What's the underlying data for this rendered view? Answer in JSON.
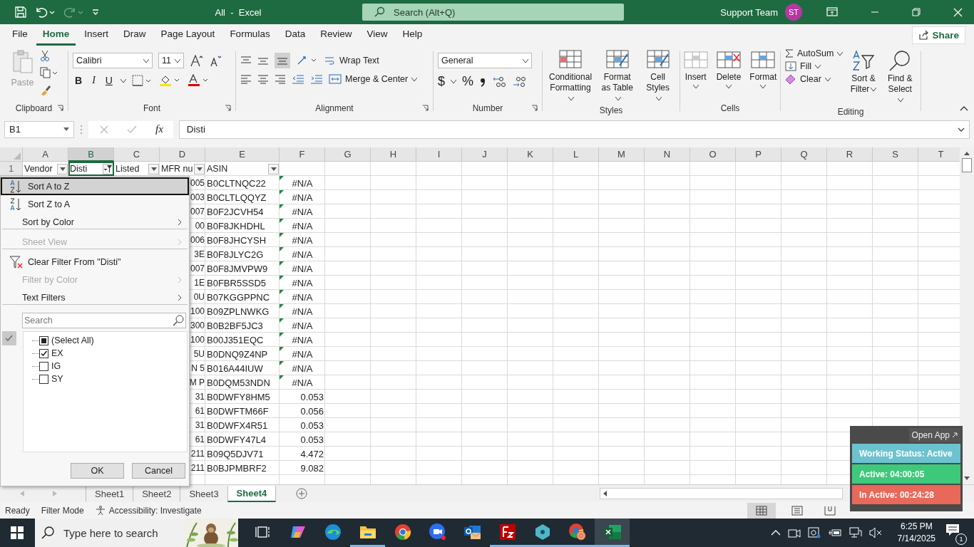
{
  "title_bar": {
    "document": "All  -  Excel",
    "search_placeholder": "Search (Alt+Q)",
    "user": "Support Team",
    "avatar_initials": "ST"
  },
  "menu_tabs": [
    {
      "label": "File",
      "selected": false
    },
    {
      "label": "Home",
      "selected": true
    },
    {
      "label": "Insert",
      "selected": false
    },
    {
      "label": "Draw",
      "selected": false
    },
    {
      "label": "Page Layout",
      "selected": false
    },
    {
      "label": "Formulas",
      "selected": false
    },
    {
      "label": "Data",
      "selected": false
    },
    {
      "label": "Review",
      "selected": false
    },
    {
      "label": "View",
      "selected": false
    },
    {
      "label": "Help",
      "selected": false
    }
  ],
  "share": "Share",
  "ribbon": {
    "clipboard": {
      "label": "Clipboard",
      "paste": "Paste"
    },
    "font": {
      "label": "Font",
      "family": "Calibri",
      "size": "11",
      "bold": "B",
      "italic": "I",
      "underline": "U"
    },
    "alignment": {
      "label": "Alignment",
      "wrap": "Wrap Text",
      "merge": "Merge & Center"
    },
    "number": {
      "label": "Number",
      "format": "General",
      "currency": "$",
      "percent": "%"
    },
    "styles": {
      "label": "Styles",
      "buttons": [
        "Conditional Formatting",
        "Format as Table",
        "Cell Styles"
      ]
    },
    "cells": {
      "label": "Cells",
      "buttons": [
        "Insert",
        "Delete",
        "Format"
      ]
    },
    "editing": {
      "label": "Editing",
      "autosum": "AutoSum",
      "fill": "Fill",
      "clear": "Clear",
      "sort": "Sort & Filter",
      "find": "Find & Select"
    }
  },
  "formula_bar": {
    "name_box": "B1",
    "fx": "fx",
    "value": "Disti"
  },
  "columns": [
    {
      "letter": "A",
      "selected": false
    },
    {
      "letter": "B",
      "selected": true
    },
    {
      "letter": "C",
      "selected": false
    },
    {
      "letter": "D",
      "selected": false
    },
    {
      "letter": "E",
      "selected": false
    },
    {
      "letter": "F",
      "selected": false
    },
    {
      "letter": "G",
      "selected": false
    },
    {
      "letter": "H",
      "selected": false
    },
    {
      "letter": "I",
      "selected": false
    },
    {
      "letter": "J",
      "selected": false
    },
    {
      "letter": "K",
      "selected": false
    },
    {
      "letter": "L",
      "selected": false
    },
    {
      "letter": "M",
      "selected": false
    },
    {
      "letter": "N",
      "selected": false
    },
    {
      "letter": "O",
      "selected": false
    },
    {
      "letter": "P",
      "selected": false
    },
    {
      "letter": "Q",
      "selected": false
    },
    {
      "letter": "R",
      "selected": false
    },
    {
      "letter": "S",
      "selected": false
    },
    {
      "letter": "T",
      "selected": false
    }
  ],
  "header_row": {
    "number": "1",
    "cells": [
      {
        "text": "Vendor",
        "filter_applied": false
      },
      {
        "text": "Disti",
        "filter_applied": true
      },
      {
        "text": "Listed",
        "filter_applied": false
      },
      {
        "text": "MFR nu",
        "filter_applied": false
      },
      {
        "text": "ASIN",
        "filter_applied": false
      }
    ]
  },
  "rows": [
    {
      "d": "005",
      "asin": "B0CLTNQC22",
      "f": "#N/A",
      "kind": "error"
    },
    {
      "d": "003",
      "asin": "B0CLTLQQYZ",
      "f": "#N/A",
      "kind": "error"
    },
    {
      "d": "007",
      "asin": "B0F2JCVH54",
      "f": "#N/A",
      "kind": "error"
    },
    {
      "d": "00",
      "asin": "B0F8JKHDHL",
      "f": "#N/A",
      "kind": "error"
    },
    {
      "d": "006",
      "asin": "B0F8JHCYSH",
      "f": "#N/A",
      "kind": "error"
    },
    {
      "d": "3E",
      "asin": "B0F8JLYC2G",
      "f": "#N/A",
      "kind": "error"
    },
    {
      "d": "007",
      "asin": "B0F8JMVPW9",
      "f": "#N/A",
      "kind": "error"
    },
    {
      "d": "1E",
      "asin": "B0FBR5SSD5",
      "f": "#N/A",
      "kind": "error"
    },
    {
      "d": "0U",
      "asin": "B07KGGPPNC",
      "f": "#N/A",
      "kind": "error"
    },
    {
      "d": "100",
      "asin": "B09ZPLNWKG",
      "f": "#N/A",
      "kind": "error"
    },
    {
      "d": "300",
      "asin": "B0B2BF5JC3",
      "f": "#N/A",
      "kind": "error"
    },
    {
      "d": "100",
      "asin": "B00J351EQC",
      "f": "#N/A",
      "kind": "error"
    },
    {
      "d": "5U",
      "asin": "B0DNQ9Z4NP",
      "f": "#N/A",
      "kind": "error"
    },
    {
      "d": "N 5",
      "asin": "B016A44IUW",
      "f": "#N/A",
      "kind": "error"
    },
    {
      "d": "M P",
      "asin": "B0DQM53NDN",
      "f": "#N/A",
      "kind": "error"
    },
    {
      "d": "31",
      "asin": "B0DWFY8HM5",
      "f": "0.053",
      "kind": "number"
    },
    {
      "d": "61",
      "asin": "B0DWFTM66F",
      "f": "0.056",
      "kind": "number"
    },
    {
      "d": "31",
      "asin": "B0DWFX4R51",
      "f": "0.053",
      "kind": "number"
    },
    {
      "d": "61",
      "asin": "B0DWFY47L4",
      "f": "0.053",
      "kind": "number"
    },
    {
      "d": "211",
      "asin": "B09Q5DJV71",
      "f": "4.472",
      "kind": "number"
    },
    {
      "d": "211",
      "asin": "B0BJPMBRF2",
      "f": "9.082",
      "kind": "number"
    }
  ],
  "filter_menu": {
    "items": [
      {
        "label": "Sort A to Z",
        "kind": "sort-asc",
        "disabled": false,
        "selected": true,
        "separator_after": false
      },
      {
        "label": "Sort Z to A",
        "kind": "sort-desc",
        "disabled": false,
        "selected": false,
        "separator_after": false
      },
      {
        "label": "Sort by Color",
        "kind": "submenu",
        "disabled": false,
        "selected": false,
        "separator_after": true
      },
      {
        "label": "Sheet View",
        "kind": "submenu",
        "disabled": true,
        "selected": false,
        "separator_after": true
      },
      {
        "label": "Clear Filter From \"Disti\"",
        "kind": "clear",
        "disabled": false,
        "selected": false,
        "separator_after": false
      },
      {
        "label": "Filter by Color",
        "kind": "submenu",
        "disabled": true,
        "selected": false,
        "separator_after": false
      },
      {
        "label": "Text Filters",
        "kind": "submenu",
        "disabled": false,
        "selected": false,
        "separator_after": true
      }
    ],
    "search_placeholder": "Search",
    "values": [
      {
        "label": "(Select All)",
        "checked": false,
        "mixed": true
      },
      {
        "label": "EX",
        "checked": true,
        "mixed": false
      },
      {
        "label": "IG",
        "checked": false,
        "mixed": false
      },
      {
        "label": "SY",
        "checked": false,
        "mixed": false
      }
    ],
    "buttons": [
      "OK",
      "Cancel"
    ]
  },
  "sheets": [
    {
      "label": "Sheet1",
      "selected": false
    },
    {
      "label": "Sheet2",
      "selected": false
    },
    {
      "label": "Sheet3",
      "selected": false
    },
    {
      "label": "Sheet4",
      "selected": true
    }
  ],
  "status_bar": {
    "ready": "Ready",
    "mode": "Filter Mode",
    "accessibility": "Accessibility: Investigate"
  },
  "tracker": {
    "open_app": "Open App",
    "statuses": [
      {
        "text": "Working Status: Active",
        "color": "#6cc3cf"
      },
      {
        "text": "Active: 04:00:05",
        "color": "#3ec97a"
      },
      {
        "text": "In Active: 00:24:28",
        "color": "#e8685a"
      }
    ]
  },
  "taskbar": {
    "search_placeholder": "Type here to search",
    "apps": [
      {
        "kind": "taskview",
        "running": false,
        "selected": false
      },
      {
        "kind": "copilot",
        "running": false,
        "selected": false
      },
      {
        "kind": "edge",
        "running": false,
        "selected": false
      },
      {
        "kind": "explorer",
        "running": true,
        "selected": false
      },
      {
        "kind": "chrome",
        "running": false,
        "selected": false
      },
      {
        "kind": "zoom",
        "running": false,
        "selected": false
      },
      {
        "kind": "outlook",
        "running": false,
        "selected": false
      },
      {
        "kind": "filezilla",
        "running": true,
        "selected": false
      },
      {
        "kind": "hexapp",
        "running": true,
        "selected": false
      },
      {
        "kind": "chrome-profile",
        "running": true,
        "selected": false
      },
      {
        "kind": "excel",
        "running": true,
        "selected": true
      }
    ],
    "time": "6:25 PM",
    "date": "7/14/2025",
    "notifications": "1"
  }
}
